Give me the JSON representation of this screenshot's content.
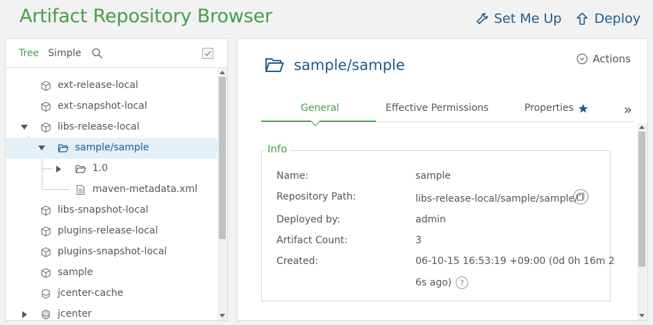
{
  "header": {
    "title": "Artifact Repository Browser",
    "set_me_up": "Set Me Up",
    "deploy": "Deploy"
  },
  "tree_panel": {
    "tabs": [
      {
        "label": "Tree",
        "active": true
      },
      {
        "label": "Simple",
        "active": false
      }
    ],
    "items": [
      {
        "label": "ext-release-local",
        "icon": "repository-icon"
      },
      {
        "label": "ext-snapshot-local",
        "icon": "repository-icon"
      },
      {
        "label": "libs-release-local",
        "icon": "repository-icon",
        "expanded": true
      },
      {
        "label": "sample/sample",
        "icon": "folder-open-icon",
        "expanded": true,
        "selected": true
      },
      {
        "label": "1.0",
        "icon": "folder-icon",
        "expanded": false
      },
      {
        "label": "maven-metadata.xml",
        "icon": "file-icon"
      },
      {
        "label": "libs-snapshot-local",
        "icon": "repository-icon"
      },
      {
        "label": "plugins-release-local",
        "icon": "repository-icon"
      },
      {
        "label": "plugins-snapshot-local",
        "icon": "repository-icon"
      },
      {
        "label": "sample",
        "icon": "repository-icon"
      },
      {
        "label": "jcenter-cache",
        "icon": "remote-cache-icon"
      },
      {
        "label": "jcenter",
        "icon": "remote-repository-icon",
        "expanded": false
      }
    ]
  },
  "detail": {
    "title": "sample/sample",
    "actions_label": "Actions",
    "tabs": [
      {
        "label": "General",
        "active": true
      },
      {
        "label": "Effective Permissions",
        "active": false
      },
      {
        "label": "Properties",
        "active": false
      }
    ],
    "more_tabs": "»",
    "info": {
      "legend": "Info",
      "rows": [
        {
          "label": "Name:",
          "value": "sample"
        },
        {
          "label": "Repository Path:",
          "value": "libs-release-local/sample/sample/"
        },
        {
          "label": "Deployed by:",
          "value": "admin"
        },
        {
          "label": "Artifact Count:",
          "value": "3"
        },
        {
          "label": "Created:",
          "value_line1": "06-10-15 16:53:19 +09:00 (0d 0h 16m 2",
          "value_line2": "6s ago)"
        }
      ],
      "help_glyph": "?"
    }
  },
  "colors": {
    "brand_green": "#43a047",
    "link_blue": "#1a5c8c",
    "selected_row": "#e3f0f8"
  }
}
